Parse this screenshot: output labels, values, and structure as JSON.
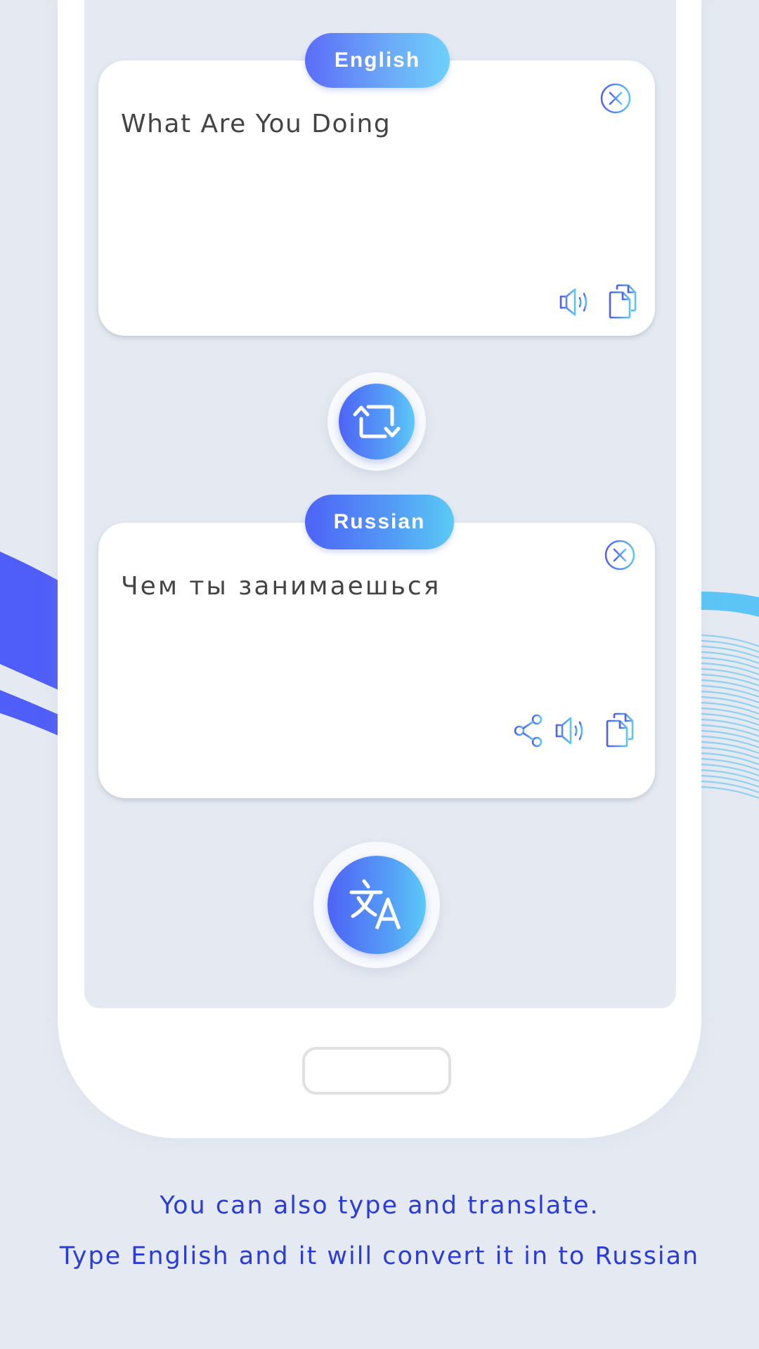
{
  "source_panel": {
    "language": "English",
    "text": "What Are You Doing",
    "actions": [
      "clear",
      "speak",
      "copy"
    ]
  },
  "swap_button": {
    "icon": "swap-icon"
  },
  "target_panel": {
    "language": "Russian",
    "text": "Чем ты занимаешься",
    "actions": [
      "clear",
      "share",
      "speak",
      "copy"
    ]
  },
  "translate_button": {
    "icon": "translate-icon"
  },
  "captions": {
    "line1": "You can also type and translate.",
    "line2": "Type English and it will convert it in to Russian"
  },
  "colors": {
    "accent_blue": "#4e63f6",
    "accent_cyan": "#5ccaf6",
    "caption_text": "#2a3bd6",
    "background": "#e5eaf2"
  }
}
